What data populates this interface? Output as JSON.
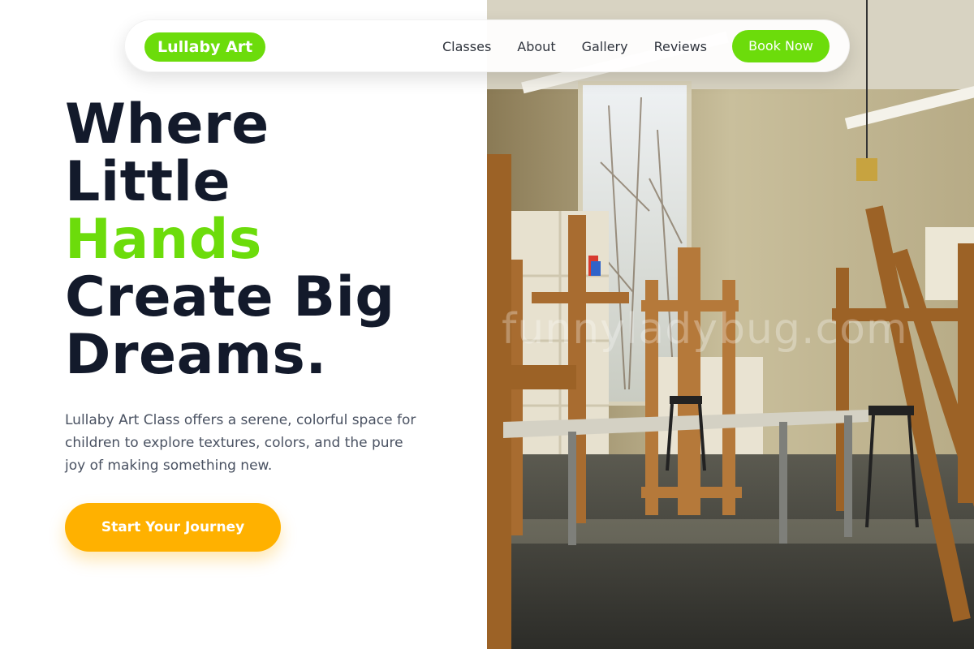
{
  "brand": {
    "logo_text": "Lullaby Art"
  },
  "nav": {
    "links": [
      {
        "label": "Classes"
      },
      {
        "label": "About"
      },
      {
        "label": "Gallery"
      },
      {
        "label": "Reviews"
      }
    ],
    "cta_label": "Book Now"
  },
  "hero": {
    "title_lines": [
      "Where",
      "Little",
      "Hands",
      "Create Big",
      "Dreams."
    ],
    "description": "Lullaby Art Class offers a serene, colorful space for children to explore textures, colors, and the pure joy of making something new.",
    "cta_label": "Start Your Journey",
    "image_watermark": "funnyladybug.com"
  },
  "colors": {
    "accent": "#6cdc0b",
    "cta": "#ffb100",
    "heading": "#131a2b",
    "body_text": "#4a5262"
  },
  "icons": [
    "art-studio-photo"
  ]
}
